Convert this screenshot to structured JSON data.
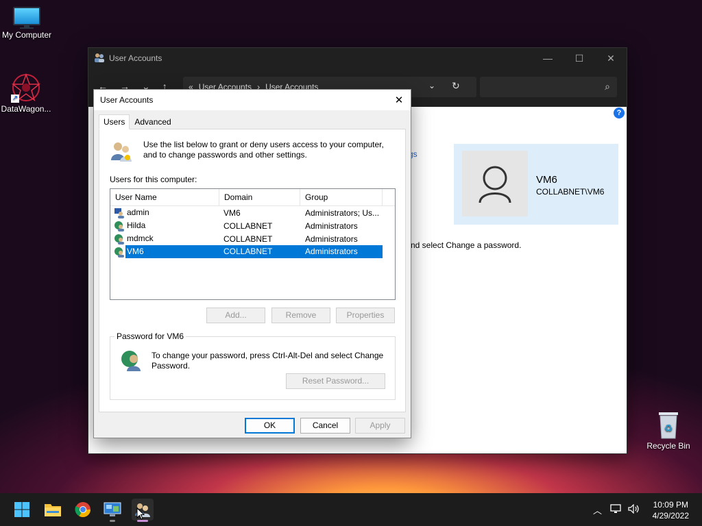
{
  "desktop": {
    "icons": [
      {
        "label": "My Computer"
      },
      {
        "label": "DataWagon..."
      },
      {
        "label": "Recycle Bin"
      }
    ]
  },
  "bg_window": {
    "title": "User Accounts",
    "controls": {
      "minimize": "—",
      "maximize": "☐",
      "close": "✕"
    },
    "breadcrumb": [
      "«",
      "User Accounts",
      "›",
      "User Accounts"
    ],
    "help": "?",
    "link_fragment": "gs",
    "user_card": {
      "name": "VM6",
      "domain": "COLLABNET\\VM6"
    },
    "hint_text": "nd select Change a password."
  },
  "dialog": {
    "title": "User Accounts",
    "close": "✕",
    "tabs": [
      "Users",
      "Advanced"
    ],
    "intro": "Use the list below to grant or deny users access to your computer, and to change passwords and other settings.",
    "users_label": "Users for this computer:",
    "columns": [
      "User Name",
      "Domain",
      "Group"
    ],
    "users": [
      {
        "name": "admin",
        "domain": "VM6",
        "group": "Administrators; Us..."
      },
      {
        "name": "Hilda",
        "domain": "COLLABNET",
        "group": "Administrators"
      },
      {
        "name": "mdmck",
        "domain": "COLLABNET",
        "group": "Administrators"
      },
      {
        "name": "VM6",
        "domain": "COLLABNET",
        "group": "Administrators"
      }
    ],
    "selected_user": "VM6",
    "buttons": {
      "add": "Add...",
      "remove": "Remove",
      "properties": "Properties"
    },
    "password_group": {
      "label": "Password for VM6",
      "text": "To change your password, press Ctrl-Alt-Del and select Change Password.",
      "reset": "Reset Password..."
    },
    "footer": {
      "ok": "OK",
      "cancel": "Cancel",
      "apply": "Apply"
    }
  },
  "taskbar": {
    "time": "10:09 PM",
    "date": "4/29/2022"
  },
  "colors": {
    "accent": "#0078d7",
    "taskbar": "#1c1c1c"
  }
}
